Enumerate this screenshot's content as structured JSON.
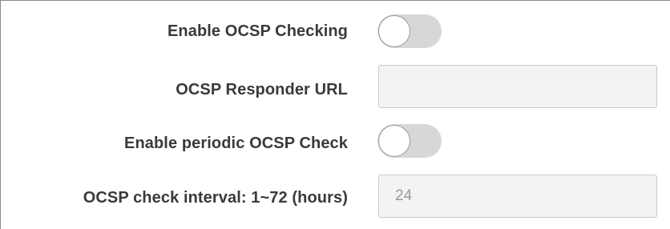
{
  "ocsp": {
    "enable_ocsp": {
      "label": "Enable OCSP Checking",
      "state": "off"
    },
    "responder_url": {
      "label": "OCSP Responder URL",
      "value": "",
      "placeholder": ""
    },
    "enable_periodic": {
      "label": "Enable periodic OCSP Check",
      "state": "off"
    },
    "check_interval": {
      "label": "OCSP check interval: 1~72 (hours)",
      "value": "24",
      "placeholder": ""
    }
  },
  "colors": {
    "label_text": "#3a3a3a",
    "toggle_track_off": "#d7d7d7",
    "field_background": "#f3f3f3",
    "field_border": "#c9c9c9",
    "field_text": "#9a9a9a"
  }
}
